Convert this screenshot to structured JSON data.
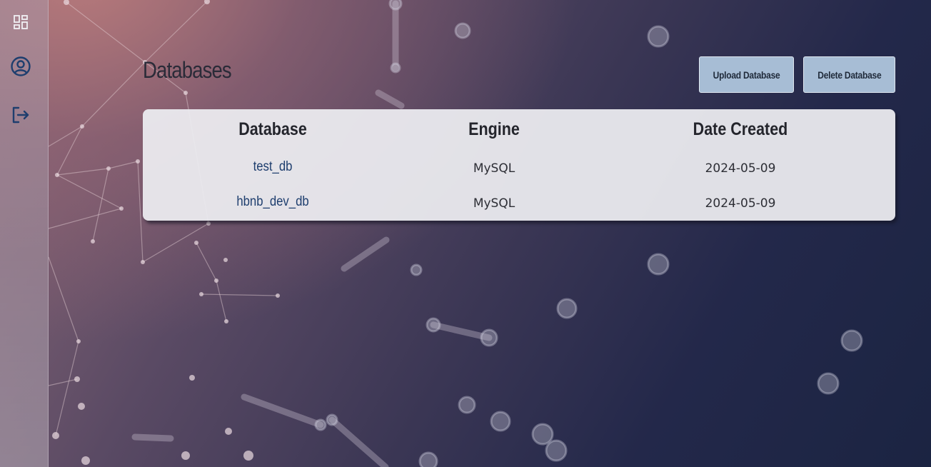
{
  "sidebar": {
    "items": [
      {
        "name": "dashboard",
        "icon": "dashboard-icon"
      },
      {
        "name": "profile",
        "icon": "user-circle-icon"
      },
      {
        "name": "logout",
        "icon": "logout-icon"
      }
    ]
  },
  "page": {
    "title": "Databases",
    "upload_label": "Upload Database",
    "delete_label": "Delete Database"
  },
  "table": {
    "headers": [
      "Database",
      "Engine",
      "Date Created"
    ],
    "rows": [
      {
        "database": "test_db",
        "engine": "MySQL",
        "date_created": "2024-05-09"
      },
      {
        "database": "hbnb_dev_db",
        "engine": "MySQL",
        "date_created": "2024-05-09"
      }
    ]
  },
  "colors": {
    "accent": "#1e3e6e",
    "button_bg": "#a7bdd5",
    "icon": "#1e3e6e"
  }
}
